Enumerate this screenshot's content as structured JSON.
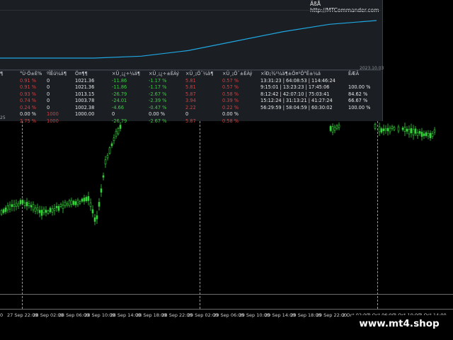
{
  "brand": "ÄßÅ http://MTCommander.com",
  "chart_date": "2023.10.03",
  "edge_label": "25",
  "stats": {
    "headers": [
      "¶",
      "°Ù·Ö±È%",
      "ºÏÊú¼ä¶",
      "Ö¤¶¶",
      "×Ü¸¡¿÷¼ä¶",
      "×Ü¸¡¿÷±ÈÀý",
      "×Ü¸¡Ö¯¼ä¶",
      "×Ü¸¡Ö¯±ÈÀý",
      "×îÐ¡¾²¼ä¶±Ö¤²Ö°Ê±¼ä",
      "ÊÆÂ"
    ],
    "rows": [
      [
        "",
        "0.91 %",
        "0",
        "1021.36",
        "-11.86",
        "-1.17 %",
        "5.81",
        "0.57 %",
        "13:31:23 | 64:08:53 | 114:46:24",
        ""
      ],
      [
        "",
        "0.91 %",
        "0",
        "1021.36",
        "-11.86",
        "-1.17 %",
        "5.81",
        "0.57 %",
        "9:15:01 | 13:23:23 | 17:45:06",
        "100.00 %"
      ],
      [
        "",
        "0.93 %",
        "0",
        "1013.15",
        "-26.79",
        "-2.67 %",
        "5.87",
        "0.58 %",
        "8:12:42 | 42:07:10 | 75:03:41",
        "84.62 %"
      ],
      [
        "",
        "0.74 %",
        "0",
        "1003.78",
        "-24.01",
        "-2.39 %",
        "3.94",
        "0.39 %",
        "15:12:24 | 31:13:21 | 41:27:24",
        "66.67 %"
      ],
      [
        "",
        "0.24 %",
        "0",
        "1002.38",
        "-4.66",
        "-0.47 %",
        "2.22",
        "0.22 %",
        "56:29:59 | 58:04:59 | 60:30:02",
        "100.00 %"
      ],
      [
        "",
        "0.00 %",
        "1000",
        "1000.00",
        "0",
        "0.00 %",
        "0",
        "0.00 %",
        "",
        ""
      ],
      [
        "",
        "2.75 %",
        "1000",
        "",
        "-26.79",
        "-2.67 %",
        "5.87",
        "0.58 %",
        "",
        ""
      ]
    ]
  },
  "equity_series": [
    0.0,
    0.0,
    0.0,
    0.05,
    0.2,
    0.45,
    0.7,
    0.9,
    1.0
  ],
  "x_axis_labels": [
    "0",
    "27 Sep 22:00",
    "28 Sep 02:00",
    "28 Sep 06:00",
    "28 Sep 10:00",
    "28 Sep 14:00",
    "28 Sep 18:00",
    "28 Sep 22:00",
    "29 Sep 02:00",
    "29 Sep 06:00",
    "29 Sep 10:00",
    "29 Sep 14:00",
    "29 Sep 18:00",
    "29 Sep 22:00",
    "2 Oct 02:00",
    "2 Oct 06:00",
    "2 Oct 10:00",
    "2 Oct 14:00"
  ],
  "watermark": "www.mt4.shop",
  "colors": {
    "bull": "#35d23a",
    "bear": "#e23a3a",
    "equity": "#1fa6e0"
  }
}
